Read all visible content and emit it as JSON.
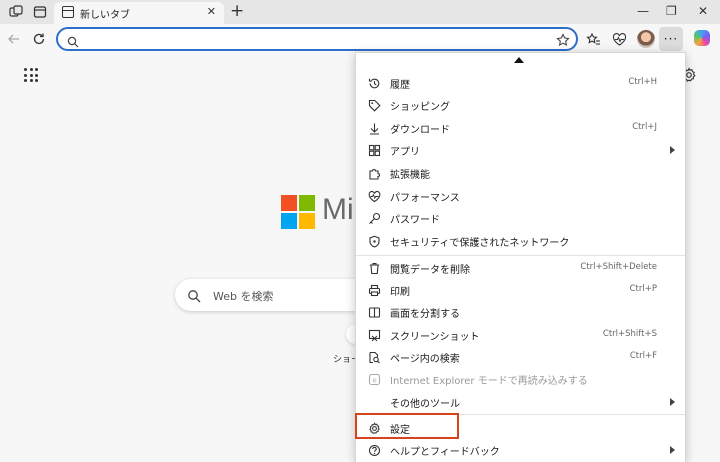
{
  "tab": {
    "title": "新しいタブ",
    "close": "✕",
    "new_tab": "+"
  },
  "window": {
    "minimize": "—",
    "restore": "❐",
    "close": "✕"
  },
  "address": {
    "value": "",
    "placeholder": ""
  },
  "profile": {
    "more": "···"
  },
  "newtab_page": {
    "brand_text": "Mi",
    "search_placeholder": "Web を検索",
    "shortcut_label": "ショー"
  },
  "colors": {
    "accent": "#2d6ecb",
    "highlight": "#d8431c",
    "ms_red": "#f25022",
    "ms_green": "#7fba00",
    "ms_blue": "#00a4ef",
    "ms_yellow": "#ffb900"
  },
  "menu": {
    "items": [
      {
        "label": "履歴",
        "shortcut": "Ctrl+H",
        "icon": "history-icon"
      },
      {
        "label": "ショッピング",
        "shortcut": "",
        "icon": "tag-icon"
      },
      {
        "label": "ダウンロード",
        "shortcut": "Ctrl+J",
        "icon": "download-icon"
      },
      {
        "label": "アプリ",
        "shortcut": "",
        "icon": "apps-icon",
        "submenu": true
      },
      {
        "label": "拡張機能",
        "shortcut": "",
        "icon": "puzzle-icon"
      },
      {
        "label": "パフォーマンス",
        "shortcut": "",
        "icon": "heart-pulse-icon"
      },
      {
        "label": "パスワード",
        "shortcut": "",
        "icon": "key-icon"
      },
      {
        "label": "セキュリティで保護されたネットワーク",
        "shortcut": "",
        "icon": "shield-icon"
      },
      {
        "label": "閲覧データを削除",
        "shortcut": "Ctrl+Shift+Delete",
        "icon": "trash-icon"
      },
      {
        "label": "印刷",
        "shortcut": "Ctrl+P",
        "icon": "printer-icon"
      },
      {
        "label": "画面を分割する",
        "shortcut": "",
        "icon": "split-screen-icon"
      },
      {
        "label": "スクリーンショット",
        "shortcut": "Ctrl+Shift+S",
        "icon": "screenshot-icon"
      },
      {
        "label": "ページ内の検索",
        "shortcut": "Ctrl+F",
        "icon": "find-icon"
      },
      {
        "label": "Internet Explorer モードで再読み込みする",
        "shortcut": "",
        "icon": "ie-mode-icon",
        "disabled": true
      },
      {
        "label": "その他のツール",
        "shortcut": "",
        "icon": "",
        "submenu": true
      },
      {
        "label": "設定",
        "shortcut": "",
        "icon": "gear-icon"
      },
      {
        "label": "ヘルプとフィードバック",
        "shortcut": "",
        "icon": "help-icon",
        "submenu": true
      }
    ]
  }
}
